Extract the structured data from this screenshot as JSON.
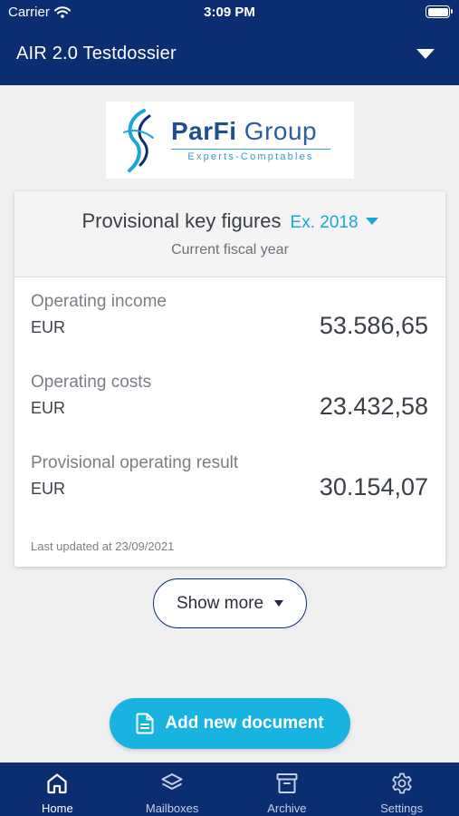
{
  "status_bar": {
    "carrier": "Carrier",
    "time": "3:09 PM"
  },
  "header": {
    "dossier_title": "AIR 2.0 Testdossier"
  },
  "logo": {
    "name_bold": "ParFi",
    "name_light": " Group",
    "tagline": "Experts-Comptables"
  },
  "key_figures": {
    "title": "Provisional key figures",
    "year_selector": "Ex. 2018",
    "subtitle": "Current fiscal year",
    "metrics": [
      {
        "label": "Operating income",
        "unit": "EUR",
        "value": "53.586,65"
      },
      {
        "label": "Operating costs",
        "unit": "EUR",
        "value": "23.432,58"
      },
      {
        "label": "Provisional operating result",
        "unit": "EUR",
        "value": "30.154,07"
      }
    ],
    "last_updated": "Last updated at 23/09/2021"
  },
  "actions": {
    "show_more": "Show more",
    "add_document": "Add new document"
  },
  "tabs": [
    {
      "label": "Home",
      "icon": "home-icon",
      "active": true
    },
    {
      "label": "Mailboxes",
      "icon": "layers-icon",
      "active": false
    },
    {
      "label": "Archive",
      "icon": "archive-box-icon",
      "active": false
    },
    {
      "label": "Settings",
      "icon": "gear-icon",
      "active": false
    }
  ],
  "colors": {
    "primary_navy": "#0b2d72",
    "accent_cyan": "#18b3e0",
    "background": "#efeff0"
  }
}
